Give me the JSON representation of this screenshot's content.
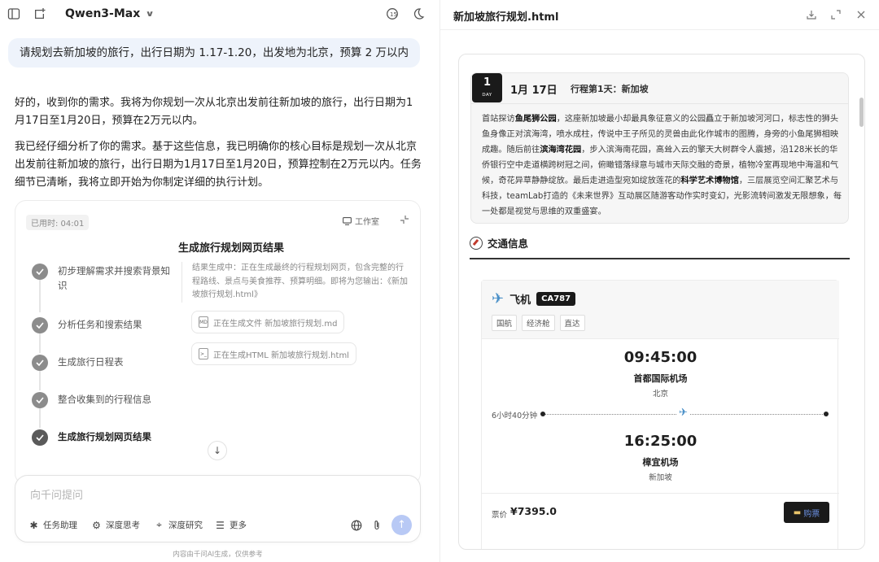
{
  "left_header": {
    "model_name": "Qwen3-Max"
  },
  "conversation": {
    "user_message": "请规划去新加坡的旅行，出行日期为 1.17-1.20，出发地为北京，预算 2 万以内",
    "reply_1": "好的，收到你的需求。我将为你规划一次从北京出发前往新加坡的旅行，出行日期为1月17日至1月20日，预算在2万元以内。",
    "reply_2": "我已经仔细分析了你的需求。基于这些信息，我已明确你的核心目标是规划一次从北京出发前往新加坡的旅行，出行日期为1月17日至1月20日，预算控制在2万元以内。任务细节已清晰，我将立即开始为你制定详细的执行计划。"
  },
  "task_panel": {
    "elapsed": "已用时: 04:01",
    "studio_label": "工作室",
    "steps": [
      {
        "label": "初步理解需求并搜索背景知识",
        "active": false
      },
      {
        "label": "分析任务和搜索结果",
        "active": false
      },
      {
        "label": "生成旅行日程表",
        "active": false
      },
      {
        "label": "整合收集到的行程信息",
        "active": false
      },
      {
        "label": "生成旅行规划网页结果",
        "active": true
      }
    ],
    "result_title": "生成旅行规划网页结果",
    "result_desc": "结果生成中：正在生成最终的行程规划网页，包含完整的行程路线、景点与美食推荐、预算明细。即将为您输出：《新加坡旅行规划.html》",
    "files": [
      {
        "icon_text": "MD",
        "label": "正在生成文件 新加坡旅行规划.md"
      },
      {
        "icon_text": ">_",
        "label": "正在生成HTML 新加坡旅行规划.html"
      }
    ]
  },
  "composer": {
    "placeholder": "向千问提问",
    "tools": [
      {
        "icon": "sparkle-icon",
        "label": "任务助理"
      },
      {
        "icon": "brain-icon",
        "label": "深度思考"
      },
      {
        "icon": "telescope-icon",
        "label": "深度研究"
      },
      {
        "icon": "list-icon",
        "label": "更多"
      }
    ],
    "disclaimer": "内容由千问AI生成，仅供参考"
  },
  "preview": {
    "file_title": "新加坡旅行规划.html",
    "day": {
      "number": "1",
      "label": "DAY",
      "date": "1月 17日",
      "subtitle": "行程第1天：新加坡",
      "text_parts": [
        {
          "t": "首站探访",
          "b": false
        },
        {
          "t": "鱼尾狮公园",
          "b": true
        },
        {
          "t": "，这座新加坡最小却最具象征意义的公园矗立于新加坡河河口，标志性的狮头鱼身像正对滨海湾，喷水成柱，传说中王子所见的灵兽由此化作城市的图腾，身旁的小鱼尾狮相映成趣。随后前往",
          "b": false
        },
        {
          "t": "滨海湾花园",
          "b": true
        },
        {
          "t": "，步入滨海南花园，高耸入云的擎天大树群令人震撼，沿128米长的华侨银行空中走道横跨树冠之间，俯瞰错落绿意与城市天际交融的奇景，植物冷室再现地中海温和气候，奇花异草静静绽放。最后走进造型宛如绽放莲花的",
          "b": false
        },
        {
          "t": "科学艺术博物馆",
          "b": true
        },
        {
          "t": "，三层展览空间汇聚艺术与科技，teamLab打造的《未来世界》互动展区随游客动作实时变幻，光影流转间激发无限想象，每一处都是视觉与思维的双重盛宴。",
          "b": false
        }
      ]
    },
    "transport": {
      "section_title": "交通信息",
      "flight": {
        "label": "飞机",
        "code": "CA787",
        "tags": [
          "国航",
          "经济舱",
          "直达"
        ],
        "depart_time": "09:45:00",
        "depart_airport": "首都国际机场",
        "depart_city": "北京",
        "duration": "6小时40分钟",
        "arrive_time": "16:25:00",
        "arrive_airport": "樟宜机场",
        "arrive_city": "新加坡",
        "price_label": "票价",
        "price": "¥7395.0",
        "buy_label": "购票"
      }
    }
  },
  "colors": {
    "accent_blue": "#4a90c8",
    "send_button": "#b8c9f5",
    "dark_badge": "#1a1a1a"
  }
}
